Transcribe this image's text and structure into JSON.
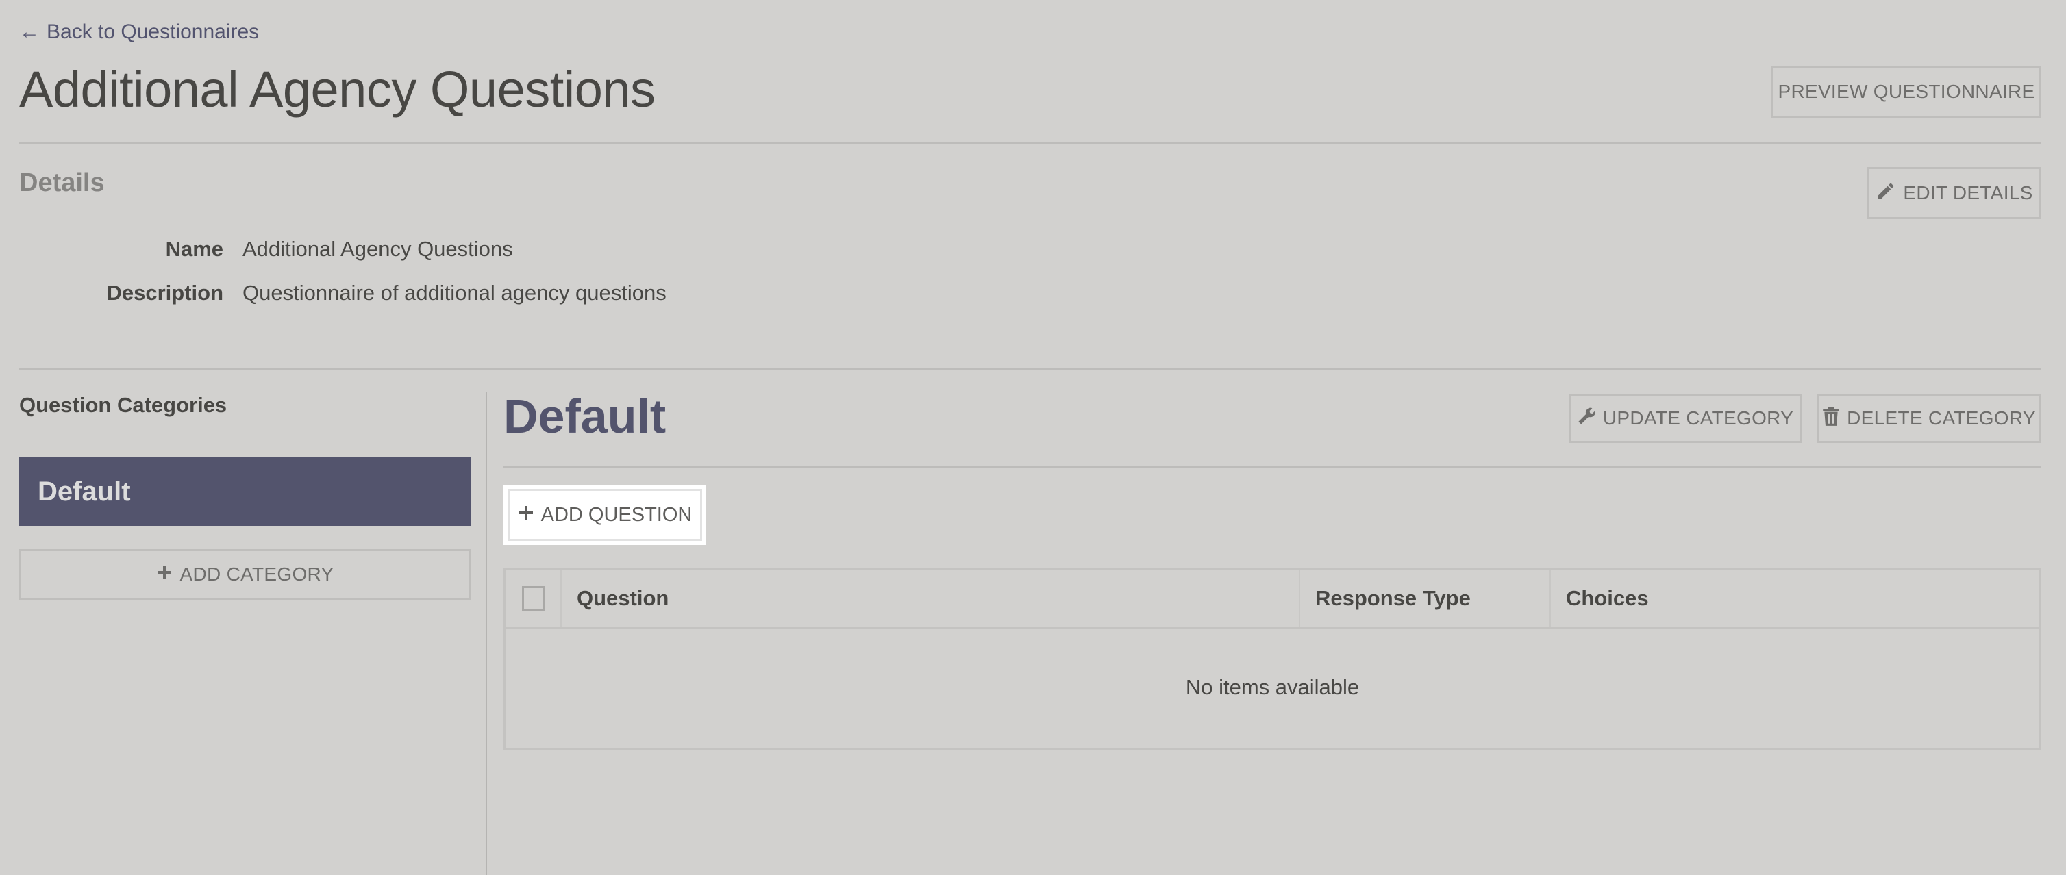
{
  "nav": {
    "back_arrow": "←",
    "back_label": "Back to Questionnaires"
  },
  "header": {
    "title": "Additional Agency Questions",
    "preview_button": "PREVIEW QUESTIONNAIRE"
  },
  "details": {
    "heading": "Details",
    "edit_button": "EDIT DETAILS",
    "fields": [
      {
        "label": "Name",
        "value": "Additional Agency Questions"
      },
      {
        "label": "Description",
        "value": "Questionnaire of additional agency questions"
      }
    ]
  },
  "sidebar": {
    "heading": "Question Categories",
    "categories": [
      {
        "label": "Default",
        "selected": true
      }
    ],
    "add_category_button": "ADD CATEGORY"
  },
  "category": {
    "title": "Default",
    "update_button": "UPDATE CATEGORY",
    "delete_button": "DELETE CATEGORY",
    "add_question_button": "ADD QUESTION",
    "table": {
      "columns": [
        "Question",
        "Response Type",
        "Choices"
      ],
      "rows": [],
      "empty_message": "No items available"
    }
  },
  "colors": {
    "background": "#d2d1cf",
    "accent": "#53546d",
    "link": "#53546f",
    "text": "#484744",
    "muted_text": "#858482"
  }
}
